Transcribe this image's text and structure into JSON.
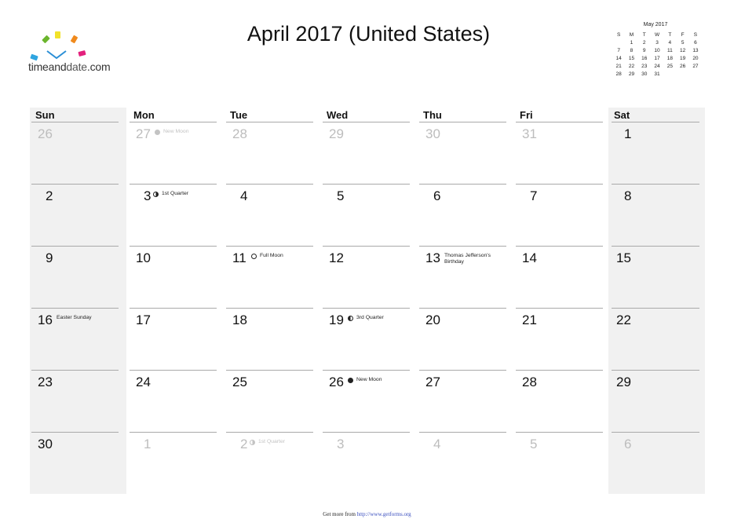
{
  "brand": {
    "name_light": "timeand",
    "name_bold": "date",
    "name_suffix": ".com"
  },
  "title": "April 2017 (United States)",
  "mini_calendar": {
    "title": "May 2017",
    "weekdays": [
      "S",
      "M",
      "T",
      "W",
      "T",
      "F",
      "S"
    ],
    "weeks": [
      [
        "",
        "1",
        "2",
        "3",
        "4",
        "5",
        "6"
      ],
      [
        "7",
        "8",
        "9",
        "10",
        "11",
        "12",
        "13"
      ],
      [
        "14",
        "15",
        "16",
        "17",
        "18",
        "19",
        "20"
      ],
      [
        "21",
        "22",
        "23",
        "24",
        "25",
        "26",
        "27"
      ],
      [
        "28",
        "29",
        "30",
        "31",
        "",
        "",
        ""
      ]
    ]
  },
  "weekdays": [
    "Sun",
    "Mon",
    "Tue",
    "Wed",
    "Thu",
    "Fri",
    "Sat"
  ],
  "weeks": [
    [
      {
        "day": "26",
        "in_month": false
      },
      {
        "day": "27",
        "in_month": false,
        "event": "New Moon",
        "moon": "new"
      },
      {
        "day": "28",
        "in_month": false
      },
      {
        "day": "29",
        "in_month": false
      },
      {
        "day": "30",
        "in_month": false
      },
      {
        "day": "31",
        "in_month": false
      },
      {
        "day": "1",
        "in_month": true
      }
    ],
    [
      {
        "day": "2",
        "in_month": true
      },
      {
        "day": "3",
        "in_month": true,
        "event": "1st Quarter",
        "moon": "first"
      },
      {
        "day": "4",
        "in_month": true
      },
      {
        "day": "5",
        "in_month": true
      },
      {
        "day": "6",
        "in_month": true
      },
      {
        "day": "7",
        "in_month": true
      },
      {
        "day": "8",
        "in_month": true
      }
    ],
    [
      {
        "day": "9",
        "in_month": true
      },
      {
        "day": "10",
        "in_month": true
      },
      {
        "day": "11",
        "in_month": true,
        "event": "Full Moon",
        "moon": "full"
      },
      {
        "day": "12",
        "in_month": true
      },
      {
        "day": "13",
        "in_month": true,
        "event": "Thomas Jefferson's Birthday"
      },
      {
        "day": "14",
        "in_month": true
      },
      {
        "day": "15",
        "in_month": true
      }
    ],
    [
      {
        "day": "16",
        "in_month": true,
        "event": "Easter Sunday"
      },
      {
        "day": "17",
        "in_month": true
      },
      {
        "day": "18",
        "in_month": true
      },
      {
        "day": "19",
        "in_month": true,
        "event": "3rd Quarter",
        "moon": "third"
      },
      {
        "day": "20",
        "in_month": true
      },
      {
        "day": "21",
        "in_month": true
      },
      {
        "day": "22",
        "in_month": true
      }
    ],
    [
      {
        "day": "23",
        "in_month": true
      },
      {
        "day": "24",
        "in_month": true
      },
      {
        "day": "25",
        "in_month": true
      },
      {
        "day": "26",
        "in_month": true,
        "event": "New Moon",
        "moon": "new"
      },
      {
        "day": "27",
        "in_month": true
      },
      {
        "day": "28",
        "in_month": true
      },
      {
        "day": "29",
        "in_month": true
      }
    ],
    [
      {
        "day": "30",
        "in_month": true
      },
      {
        "day": "1",
        "in_month": false
      },
      {
        "day": "2",
        "in_month": false,
        "event": "1st Quarter",
        "moon": "first"
      },
      {
        "day": "3",
        "in_month": false
      },
      {
        "day": "4",
        "in_month": false
      },
      {
        "day": "5",
        "in_month": false
      },
      {
        "day": "6",
        "in_month": false
      }
    ]
  ],
  "footer": {
    "prefix": "Get more from ",
    "link": "http://www.getforms.org"
  },
  "colors": {
    "weekend_shade": "#f1f1f1",
    "dim_text": "#bdbdbd",
    "link": "#3b4fbf"
  }
}
